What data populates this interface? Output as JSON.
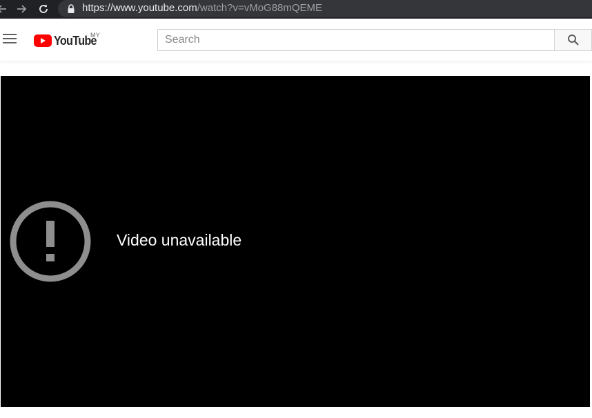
{
  "browser": {
    "url_host": "https://www.youtube.com",
    "url_path": "/watch?v=vMoG88mQEME"
  },
  "masthead": {
    "logo_text": "YouTube",
    "country_code": "MY",
    "search": {
      "placeholder": "Search",
      "value": ""
    },
    "brand_color": "#ff0000"
  },
  "player": {
    "error_message": "Video unavailable",
    "error_icon": "alert-circle-icon"
  }
}
